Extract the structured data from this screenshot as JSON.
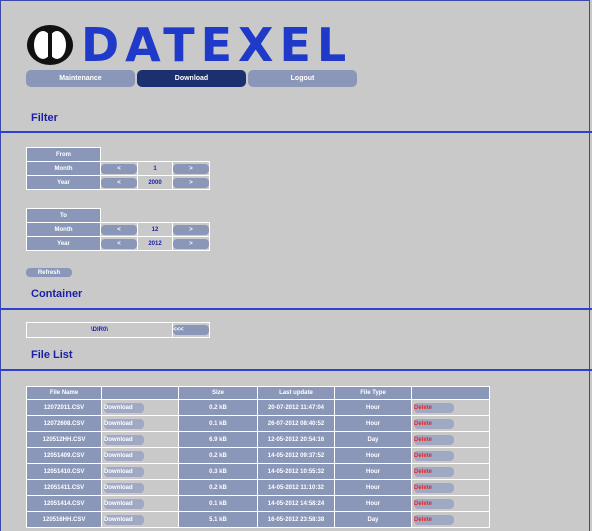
{
  "brand": {
    "name": "DATEXEL"
  },
  "nav": [
    {
      "label": "Maintenance",
      "active": false
    },
    {
      "label": "Download",
      "active": true
    },
    {
      "label": "Logout",
      "active": false
    }
  ],
  "filter": {
    "title": "Filter",
    "from": {
      "header": "From",
      "month_label": "Month",
      "month_value": "1",
      "year_label": "Year",
      "year_value": "2000"
    },
    "to": {
      "header": "To",
      "month_label": "Month",
      "month_value": "12",
      "year_label": "Year",
      "year_value": "2012"
    },
    "prev_label": "<",
    "next_label": ">",
    "refresh_label": "Refresh"
  },
  "container": {
    "title": "Container",
    "path": "\\DIR0\\",
    "back_label": "<<<"
  },
  "file_list": {
    "title": "File List",
    "columns": [
      "File Name",
      "",
      "Size",
      "Last update",
      "File Type",
      ""
    ],
    "download_label": "Download",
    "delete_label": "Delete",
    "rows": [
      {
        "name": "12072011.CSV",
        "size": "0.2 kB",
        "updated": "20-07-2012 11:47:04",
        "type": "Hour"
      },
      {
        "name": "12072608.CSV",
        "size": "0.1 kB",
        "updated": "26-07-2012 08:40:52",
        "type": "Hour"
      },
      {
        "name": "120512HH.CSV",
        "size": "6.9 kB",
        "updated": "12-05-2012 20:54:16",
        "type": "Day"
      },
      {
        "name": "12051409.CSV",
        "size": "0.2 kB",
        "updated": "14-05-2012 09:37:52",
        "type": "Hour"
      },
      {
        "name": "12051410.CSV",
        "size": "0.3 kB",
        "updated": "14-05-2012 10:55:32",
        "type": "Hour"
      },
      {
        "name": "12051411.CSV",
        "size": "0.2 kB",
        "updated": "14-05-2012 11:10:32",
        "type": "Hour"
      },
      {
        "name": "12051414.CSV",
        "size": "0.1 kB",
        "updated": "14-05-2012 14:58:24",
        "type": "Hour"
      },
      {
        "name": "120516HH.CSV",
        "size": "5.1 kB",
        "updated": "16-05-2012 23:58:38",
        "type": "Day"
      }
    ]
  },
  "colors": {
    "accent": "#1f39c8",
    "nav_active": "#1c2f6e",
    "button": "#8a97b8",
    "delete_text": "#e8262b"
  }
}
